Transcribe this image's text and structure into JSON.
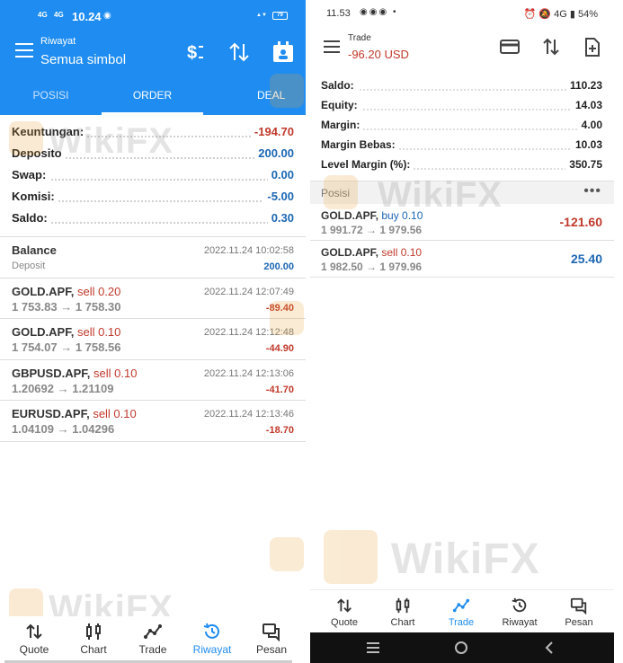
{
  "left": {
    "status": {
      "sig1": "4G",
      "sig2": "4G",
      "time": "10.24",
      "battery": "79"
    },
    "appbar": {
      "subtitle": "Riwayat",
      "title": "Semua simbol"
    },
    "tabs": [
      {
        "label": "POSISI",
        "active": false
      },
      {
        "label": "ORDER",
        "active": true
      },
      {
        "label": "DEAL",
        "active": false
      }
    ],
    "summary": [
      {
        "label": "Keuntungan:",
        "value": "-194.70",
        "negative": true
      },
      {
        "label": "Deposito",
        "value": "200.00",
        "negative": false
      },
      {
        "label": "Swap:",
        "value": "0.00",
        "negative": false
      },
      {
        "label": "Komisi:",
        "value": "-5.00",
        "negative": false
      },
      {
        "label": "Saldo:",
        "value": "0.30",
        "negative": false
      }
    ],
    "history": [
      {
        "symbol": "Balance",
        "side": "",
        "sub": "Deposit",
        "date": "2022.11.24 10:02:58",
        "value": "200.00",
        "positive": true
      },
      {
        "symbol": "GOLD.APF,",
        "side": "sell 0.20",
        "sub": "1 753.83 → 1 758.30",
        "date": "2022.11.24 12:07:49",
        "value": "-89.40",
        "positive": false
      },
      {
        "symbol": "GOLD.APF,",
        "side": "sell 0.10",
        "sub": "1 754.07 → 1 758.56",
        "date": "2022.11.24 12:12:48",
        "value": "-44.90",
        "positive": false
      },
      {
        "symbol": "GBPUSD.APF,",
        "side": "sell 0.10",
        "sub": "1.20692 → 1.21109",
        "date": "2022.11.24 12:13:06",
        "value": "-41.70",
        "positive": false
      },
      {
        "symbol": "EURUSD.APF,",
        "side": "sell 0.10",
        "sub": "1.04109 → 1.04296",
        "date": "2022.11.24 12:13:46",
        "value": "-18.70",
        "positive": false
      }
    ],
    "nav": [
      {
        "label": "Quote",
        "icon": "quote-arrows-icon"
      },
      {
        "label": "Chart",
        "icon": "candlestick-chart-icon"
      },
      {
        "label": "Trade",
        "icon": "trade-line-icon"
      },
      {
        "label": "Riwayat",
        "icon": "history-clock-icon",
        "active": true
      },
      {
        "label": "Pesan",
        "icon": "messages-icon"
      }
    ]
  },
  "right": {
    "status": {
      "time": "11.53",
      "battery": "54%",
      "net": "4G"
    },
    "appbar": {
      "title": "Trade",
      "subtitle": "-96.20 USD"
    },
    "summary": [
      {
        "label": "Saldo:",
        "value": "110.23"
      },
      {
        "label": "Equity:",
        "value": "14.03"
      },
      {
        "label": "Margin:",
        "value": "4.00"
      },
      {
        "label": "Margin Bebas:",
        "value": "10.03"
      },
      {
        "label": "Level Margin (%):",
        "value": "350.75"
      }
    ],
    "positions_header": "Posisi",
    "positions": [
      {
        "symbol": "GOLD.APF,",
        "side": "buy 0.10",
        "side_type": "buy",
        "sub": "1 991.72 → 1 979.56",
        "value": "-121.60"
      },
      {
        "symbol": "GOLD.APF,",
        "side": "sell 0.10",
        "side_type": "sell",
        "sub": "1 982.50 → 1 979.96",
        "value": "25.40"
      }
    ],
    "nav": [
      {
        "label": "Quote",
        "icon": "quote-arrows-icon"
      },
      {
        "label": "Chart",
        "icon": "candlestick-chart-icon"
      },
      {
        "label": "Trade",
        "icon": "trade-line-icon",
        "active": true
      },
      {
        "label": "Riwayat",
        "icon": "history-clock-icon"
      },
      {
        "label": "Pesan",
        "icon": "messages-icon"
      }
    ]
  },
  "watermark": "WikiFX",
  "colors": {
    "accent": "#1e8cf0",
    "negative": "#c0392b",
    "positive": "#1b66b3"
  }
}
